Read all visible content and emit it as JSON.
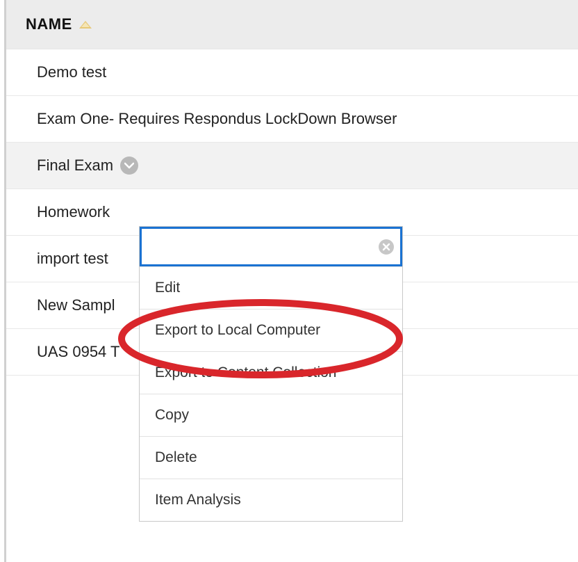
{
  "header": {
    "column_label": "NAME"
  },
  "rows": [
    {
      "label": "Demo test"
    },
    {
      "label": "Exam One- Requires Respondus LockDown Browser"
    },
    {
      "label": "Final Exam",
      "selected": true,
      "has_dropdown": true
    },
    {
      "label": "Homework"
    },
    {
      "label": "import test"
    },
    {
      "label": "New Sampl"
    },
    {
      "label": "UAS 0954 T"
    }
  ],
  "dropdown": {
    "search_value": "",
    "items": [
      "Edit",
      "Export to Local Computer",
      "Export to Content Collection",
      "Copy",
      "Delete",
      "Item Analysis"
    ]
  }
}
